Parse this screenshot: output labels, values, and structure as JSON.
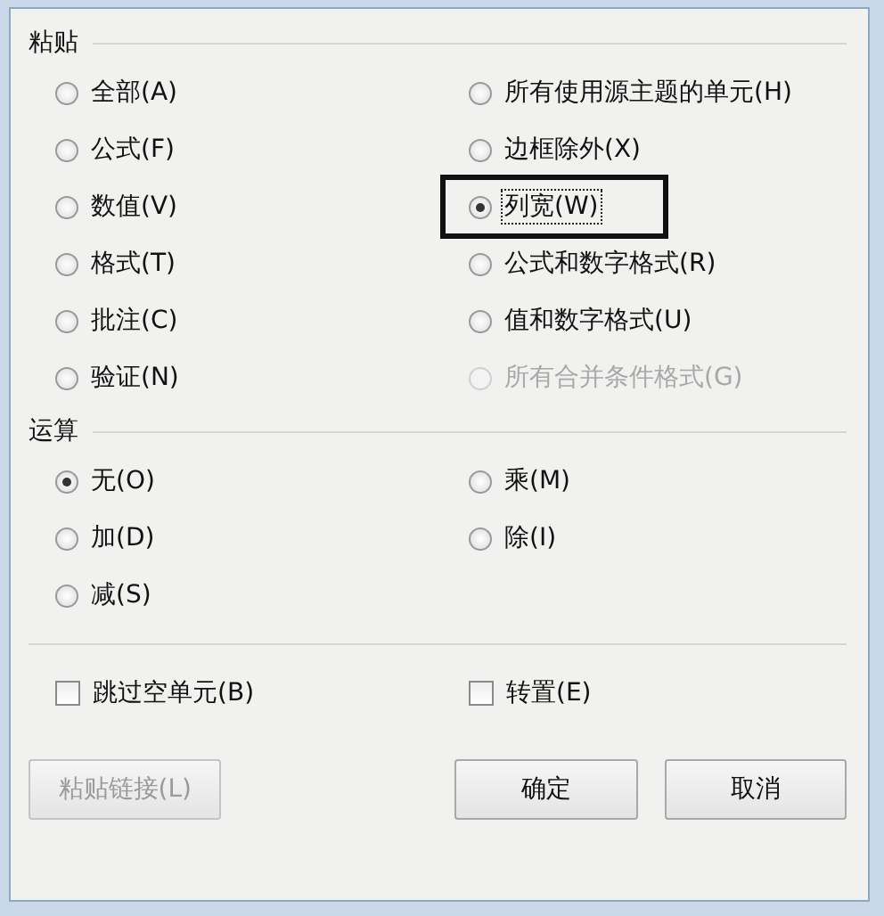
{
  "paste": {
    "heading": "粘贴",
    "options": [
      {
        "label": "全部(A)",
        "selected": false,
        "disabled": false,
        "focused": false,
        "highlighted": false
      },
      {
        "label": "所有使用源主题的单元(H)",
        "selected": false,
        "disabled": false,
        "focused": false,
        "highlighted": false
      },
      {
        "label": "公式(F)",
        "selected": false,
        "disabled": false,
        "focused": false,
        "highlighted": false
      },
      {
        "label": "边框除外(X)",
        "selected": false,
        "disabled": false,
        "focused": false,
        "highlighted": false
      },
      {
        "label": "数值(V)",
        "selected": false,
        "disabled": false,
        "focused": false,
        "highlighted": false
      },
      {
        "label": "列宽(W)",
        "selected": true,
        "disabled": false,
        "focused": true,
        "highlighted": true
      },
      {
        "label": "格式(T)",
        "selected": false,
        "disabled": false,
        "focused": false,
        "highlighted": false
      },
      {
        "label": "公式和数字格式(R)",
        "selected": false,
        "disabled": false,
        "focused": false,
        "highlighted": false
      },
      {
        "label": "批注(C)",
        "selected": false,
        "disabled": false,
        "focused": false,
        "highlighted": false
      },
      {
        "label": "值和数字格式(U)",
        "selected": false,
        "disabled": false,
        "focused": false,
        "highlighted": false
      },
      {
        "label": "验证(N)",
        "selected": false,
        "disabled": false,
        "focused": false,
        "highlighted": false
      },
      {
        "label": "所有合并条件格式(G)",
        "selected": false,
        "disabled": true,
        "focused": false,
        "highlighted": false
      }
    ]
  },
  "operation": {
    "heading": "运算",
    "options": [
      {
        "label": "无(O)",
        "selected": true
      },
      {
        "label": "乘(M)",
        "selected": false
      },
      {
        "label": "加(D)",
        "selected": false
      },
      {
        "label": "除(I)",
        "selected": false
      },
      {
        "label": "减(S)",
        "selected": false
      }
    ]
  },
  "checkboxes": [
    {
      "label": "跳过空单元(B)",
      "checked": false
    },
    {
      "label": "转置(E)",
      "checked": false
    }
  ],
  "buttons": [
    {
      "label": "粘贴链接(L)",
      "disabled": true
    },
    {
      "label": "确定",
      "disabled": false
    },
    {
      "label": "取消",
      "disabled": false
    }
  ]
}
